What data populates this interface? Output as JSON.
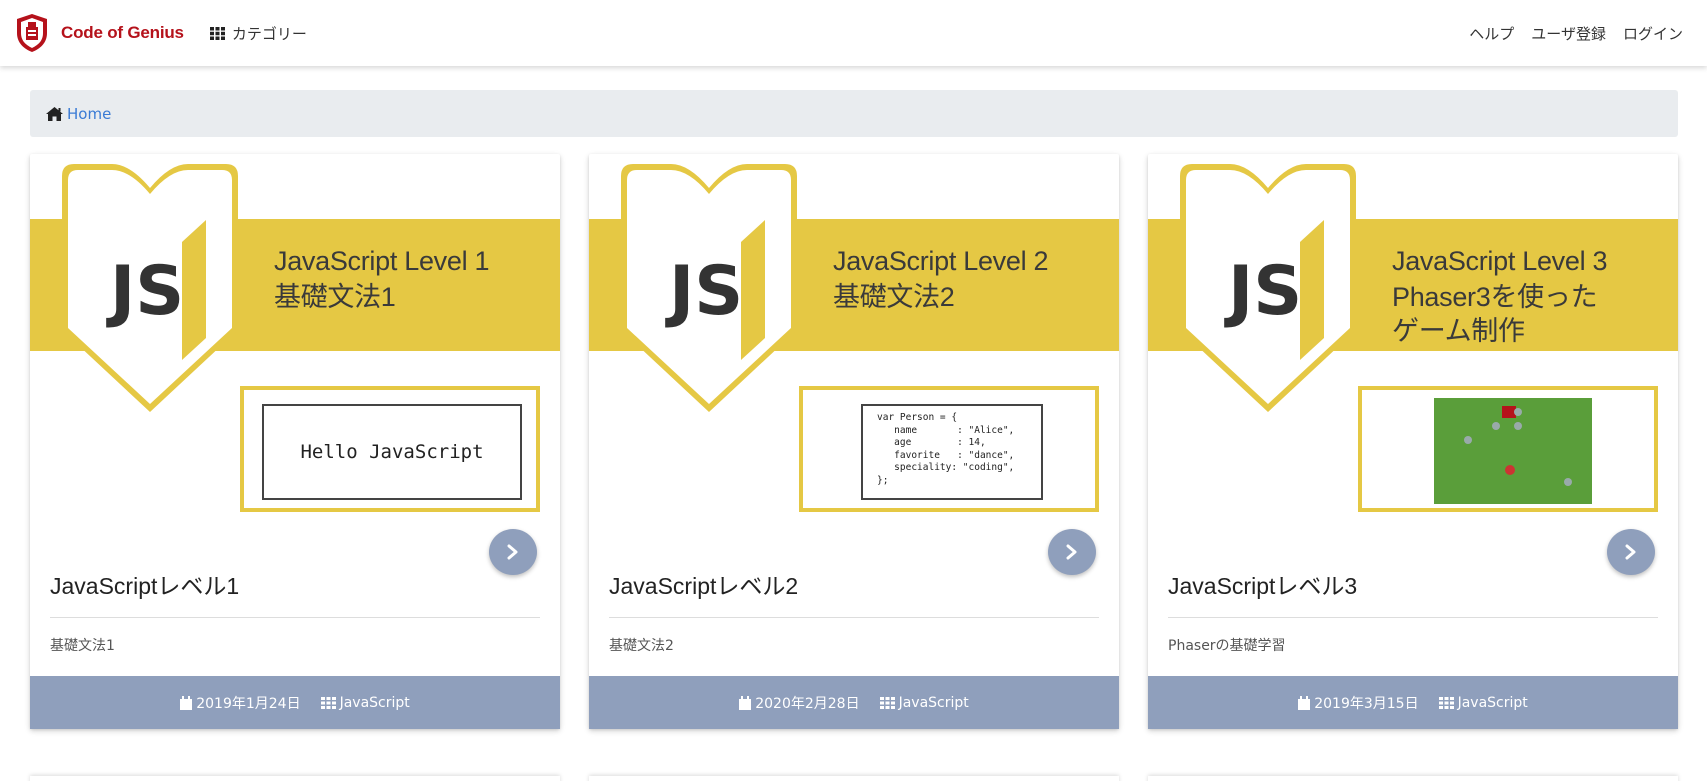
{
  "navbar": {
    "brand_name": "Code of Genius",
    "category_label": "カテゴリー",
    "links": [
      "ヘルプ",
      "ユーザ登録",
      "ログイン"
    ]
  },
  "breadcrumb": {
    "home_label": "Home"
  },
  "colors": {
    "brand_red": "#b5121b",
    "banner_yellow": "#e5c844",
    "card_footer": "#8f9fbc",
    "link_blue": "#3a7bd5"
  },
  "cards": [
    {
      "banner_lines": [
        "JavaScript Level 1",
        "基礎文法1"
      ],
      "preview_text": "Hello JavaScript",
      "title": "JavaScriptレベル1",
      "description": "基礎文法1",
      "date": "2019年1月24日",
      "category": "JavaScript"
    },
    {
      "banner_lines": [
        "JavaScript Level 2",
        "基礎文法2"
      ],
      "preview_code": "var Person = {\n   name       : \"Alice\",\n   age        : 14,\n   favorite   : \"dance\",\n   speciality: \"coding\",\n};",
      "title": "JavaScriptレベル2",
      "description": "基礎文法2",
      "date": "2020年2月28日",
      "category": "JavaScript"
    },
    {
      "banner_lines": [
        "JavaScript Level 3",
        "Phaser3を使った",
        "ゲーム制作"
      ],
      "title": "JavaScriptレベル3",
      "description": "Phaserの基礎学習",
      "date": "2019年3月15日",
      "category": "JavaScript"
    }
  ],
  "icons": {
    "logo": "shield-logo-icon",
    "category": "grid-icon",
    "home": "home-icon",
    "next": "chevron-right-icon",
    "date": "calendar-icon",
    "tag": "grid-icon"
  }
}
